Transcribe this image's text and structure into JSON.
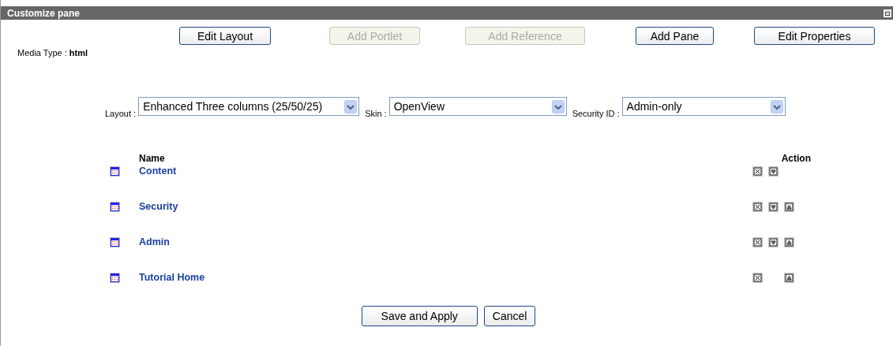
{
  "window": {
    "title": "Customize pane"
  },
  "toolbar": [
    {
      "label": "Edit Layout",
      "disabled": false
    },
    {
      "label": "Add Portlet",
      "disabled": true
    },
    {
      "label": "Add Reference",
      "disabled": true
    },
    {
      "label": "Add Pane",
      "disabled": false
    },
    {
      "label": "Edit Properties",
      "disabled": false
    }
  ],
  "media_type": {
    "label": "Media Type :",
    "value": "html"
  },
  "selects": [
    {
      "label": "Layout :",
      "value": "Enhanced Three columns (25/50/25)"
    },
    {
      "label": "Skin :",
      "value": "OpenView"
    },
    {
      "label": "Security ID :",
      "value": "Admin-only"
    }
  ],
  "table": {
    "columns": [
      "Name",
      "Action"
    ],
    "rows": [
      {
        "name": "Content",
        "can_delete": true,
        "can_move_down": true,
        "can_move_up": false
      },
      {
        "name": "Security",
        "can_delete": true,
        "can_move_down": true,
        "can_move_up": true
      },
      {
        "name": "Admin",
        "can_delete": true,
        "can_move_down": true,
        "can_move_up": true
      },
      {
        "name": "Tutorial Home",
        "can_delete": true,
        "can_move_down": false,
        "can_move_up": true
      }
    ]
  },
  "buttons": [
    "Save and Apply",
    "Cancel"
  ]
}
